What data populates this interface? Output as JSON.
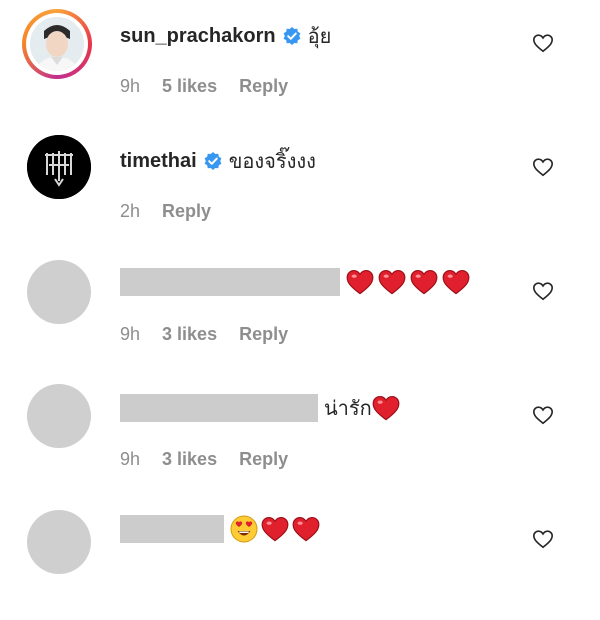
{
  "comments": [
    {
      "username": "sun_prachakorn",
      "text": "อุ้ย",
      "time": "9h",
      "likes": "5 likes",
      "reply": "Reply"
    },
    {
      "username": "timethai",
      "text": "ของจริ๊งงง",
      "time": "2h",
      "reply": "Reply"
    },
    {
      "time": "9h",
      "likes": "3 likes",
      "reply": "Reply"
    },
    {
      "text": "น่ารัก",
      "time": "9h",
      "likes": "3 likes",
      "reply": "Reply"
    },
    {}
  ],
  "colors": {
    "verified": "#3897f0",
    "heart": "#e0202d",
    "meta": "#8e8e8e",
    "redact": "#cccccc"
  },
  "icons": [
    "verified-badge-icon",
    "like-heart-outline-icon",
    "red-heart-emoji",
    "heart-eyes-emoji"
  ]
}
